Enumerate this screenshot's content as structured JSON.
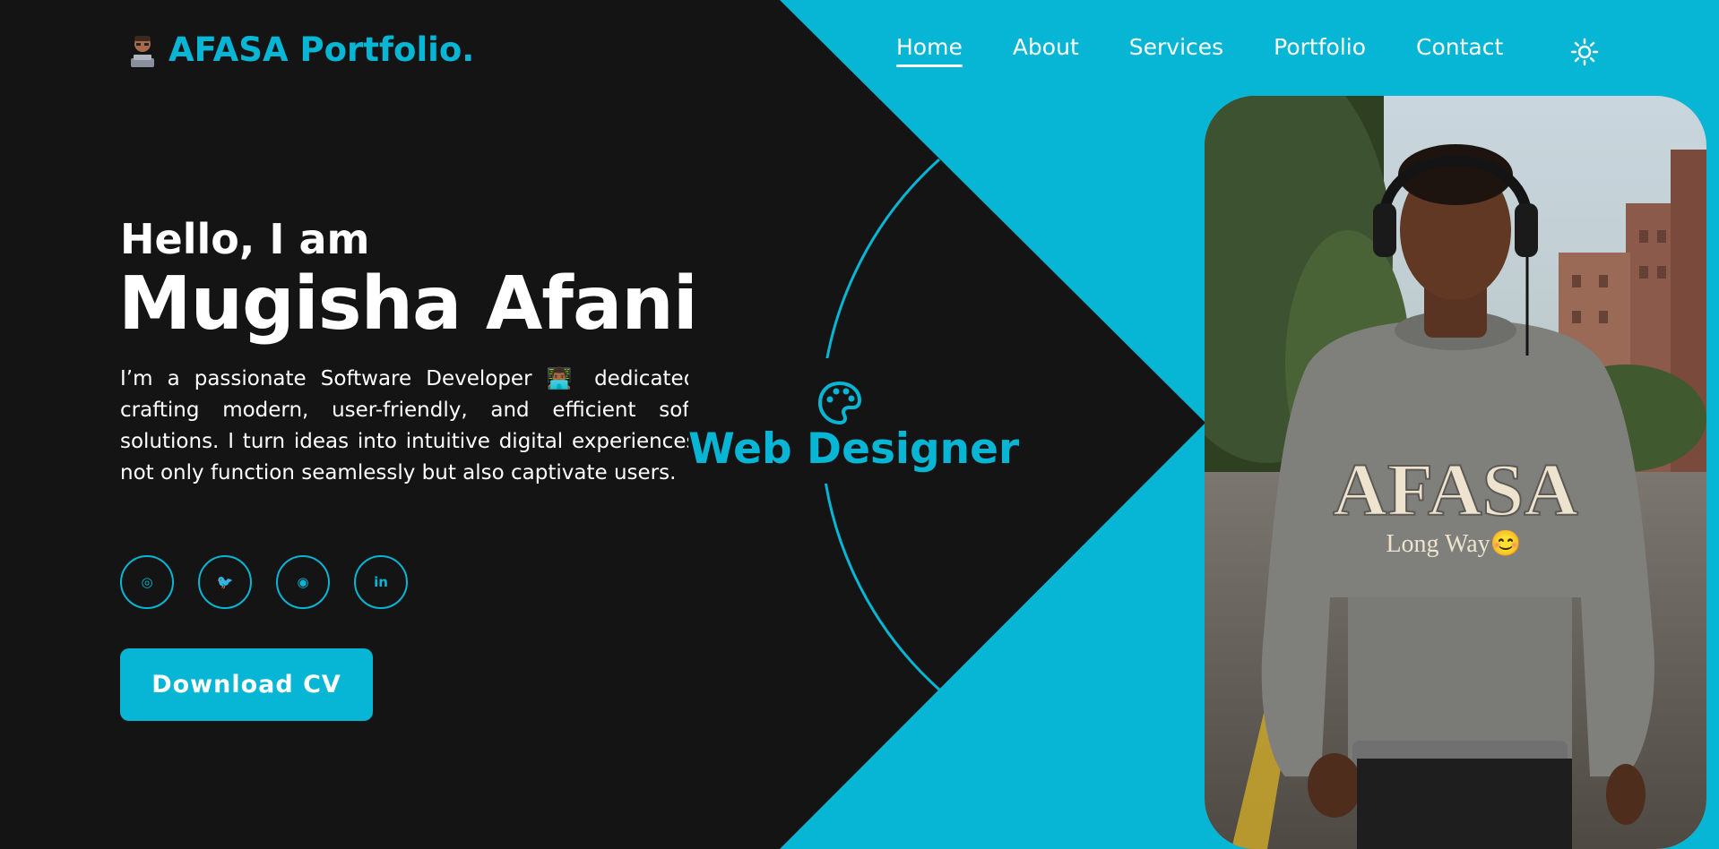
{
  "brand": {
    "logo_emoji": "technologist-emoji",
    "title": "AFASA Portfolio."
  },
  "nav": {
    "items": [
      "Home",
      "About",
      "Services",
      "Portfolio",
      "Contact"
    ],
    "active": "Home",
    "theme_toggle_icon": "sun-icon"
  },
  "hero": {
    "greeting": "Hello, I am",
    "name": "Mugisha Afani",
    "bio": "I’m a passionate Software Developer 👨🏾‍💻 dedicated to crafting modern, user-friendly, and efficient software solutions. I turn ideas into intuitive digital experiences that not only function seamlessly but also captivate users.",
    "socials": [
      "instagram-icon",
      "twitter-icon",
      "github-icon",
      "linkedin-icon"
    ],
    "social_glyphs": [
      "◎",
      "🐦",
      "◉",
      "in"
    ],
    "cta": "Download CV",
    "role": "Web Designer",
    "role_icon": "palette-icon"
  },
  "photo": {
    "sweatshirt_brand": "AFASA",
    "sweatshirt_tagline": "Long Way😊"
  },
  "colors": {
    "accent": "#06b6d4",
    "background": "#141414",
    "text": "#ffffff"
  }
}
